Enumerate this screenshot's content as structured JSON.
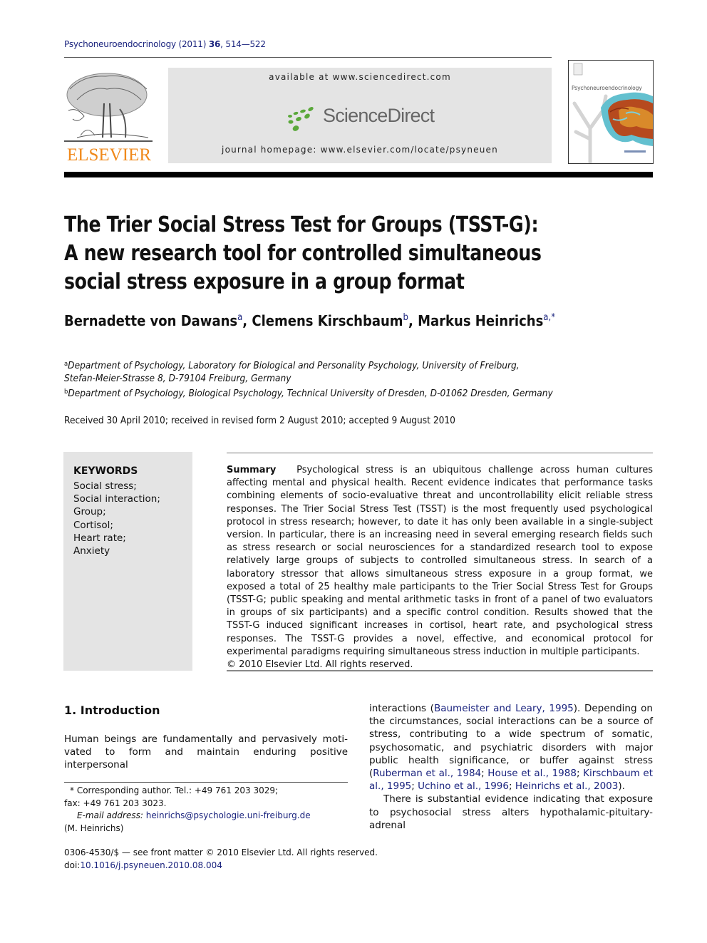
{
  "header": {
    "journal": "Psychoneuroendocrinology",
    "year": "(2011)",
    "volume": "36",
    "pages": "514—522",
    "publisher_logo": "ELSEVIER",
    "available_at": "available at www.sciencedirect.com",
    "sciencedirect_logo": "ScienceDirect",
    "journal_homepage": "journal homepage: www.elsevier.com/locate/psyneuen",
    "cover_title": "Psychoneuroendocrinology"
  },
  "article": {
    "title_lines": [
      "The Trier Social Stress Test for Groups (TSST-G):",
      "A new research tool for controlled simultaneous",
      "social stress exposure in a group format"
    ],
    "authors": [
      {
        "name": "Bernadette von Dawans",
        "sup": "a"
      },
      {
        "name": "Clemens Kirschbaum",
        "sup": "b"
      },
      {
        "name": "Markus Heinrichs",
        "sup": "a,*"
      }
    ],
    "affiliations": [
      {
        "sup": "a",
        "line1": "Department of Psychology, Laboratory for Biological and Personality Psychology, University of Freiburg,",
        "line2": "Stefan-Meier-Strasse 8, D-79104 Freiburg, Germany"
      },
      {
        "sup": "b",
        "line1": "Department of Psychology, Biological Psychology, Technical University of Dresden, D-01062 Dresden, Germany"
      }
    ],
    "received": "Received 30 April 2010; received in revised form 2 August 2010; accepted 9 August 2010"
  },
  "keywords": {
    "heading": "KEYWORDS",
    "items": [
      "Social stress;",
      "Social interaction;",
      "Group;",
      "Cortisol;",
      "Heart rate;",
      "Anxiety"
    ]
  },
  "abstract": {
    "label": "Summary",
    "text": "Psychological stress is an ubiquitous challenge across human cultures affecting mental and physical health. Recent evidence indicates that performance tasks combining elements of socio-evaluative threat and uncontrollability elicit reliable stress responses. The Trier Social Stress Test (TSST) is the most frequently used psychological protocol in stress research; however, to date it has only been available in a single-subject version. In particular, there is an increasing need in several emerging research fields such as stress research or social neurosciences for a standardized research tool to expose relatively large groups of subjects to controlled simultaneous stress. In search of a laboratory stressor that allows simultaneous stress exposure in a group format, we exposed a total of 25 healthy male participants to the Trier Social Stress Test for Groups (TSST-G; public speaking and mental arithmetic tasks in front of a panel of two evaluators in groups of six participants) and a specific control condition. Results showed that the TSST-G induced significant increases in cortisol, heart rate, and psychological stress responses. The TSST-G provides a novel, effective, and economical protocol for experimental paradigms requiring simultaneous stress induction in multiple participants.",
    "copyright": "© 2010 Elsevier Ltd. All rights reserved."
  },
  "introduction": {
    "heading": "1.  Introduction",
    "left_text": "Human beings are fundamentally and pervasively moti-vated to form and maintain enduring positive interpersonal",
    "right": {
      "p1_start": "interactions (",
      "cite1": "Baumeister and Leary, 1995",
      "p1_mid": "). Depending on the circumstances, social interactions can be a source of stress, contributing to a wide spectrum of somatic, psychosomatic, and psychiatric disorders with major public health significance, or buffer against stress (",
      "cites": [
        "Ruberman et al., 1984",
        "House et al., 1988",
        "Kirschbaum et al., 1995",
        "Uchino et al., 1996",
        "Heinrichs et al., 2003"
      ],
      "p1_end": ").",
      "p2": "There is substantial evidence indicating that exposure to psychosocial stress alters hypothalamic-pituitary-adrenal"
    }
  },
  "footnote": {
    "corresponding": "* Corresponding author. Tel.: +49 761 203 3029;",
    "fax": "fax: +49 761 203 3023.",
    "email_label": "E-mail address:",
    "email": "heinrichs@psychologie.uni-freiburg.de",
    "name": "(M. Heinrichs)"
  },
  "front_matter": {
    "issn_line": "0306-4530/$ — see front matter © 2010 Elsevier Ltd. All rights reserved.",
    "doi_label": "doi:",
    "doi": "10.1016/j.psyneuen.2010.08.004"
  },
  "colors": {
    "link": "#1a237e",
    "elsevier_orange": "#f08a1c",
    "sciencedirect_green": "#5aa83a",
    "panel_gray": "#e4e4e4"
  }
}
